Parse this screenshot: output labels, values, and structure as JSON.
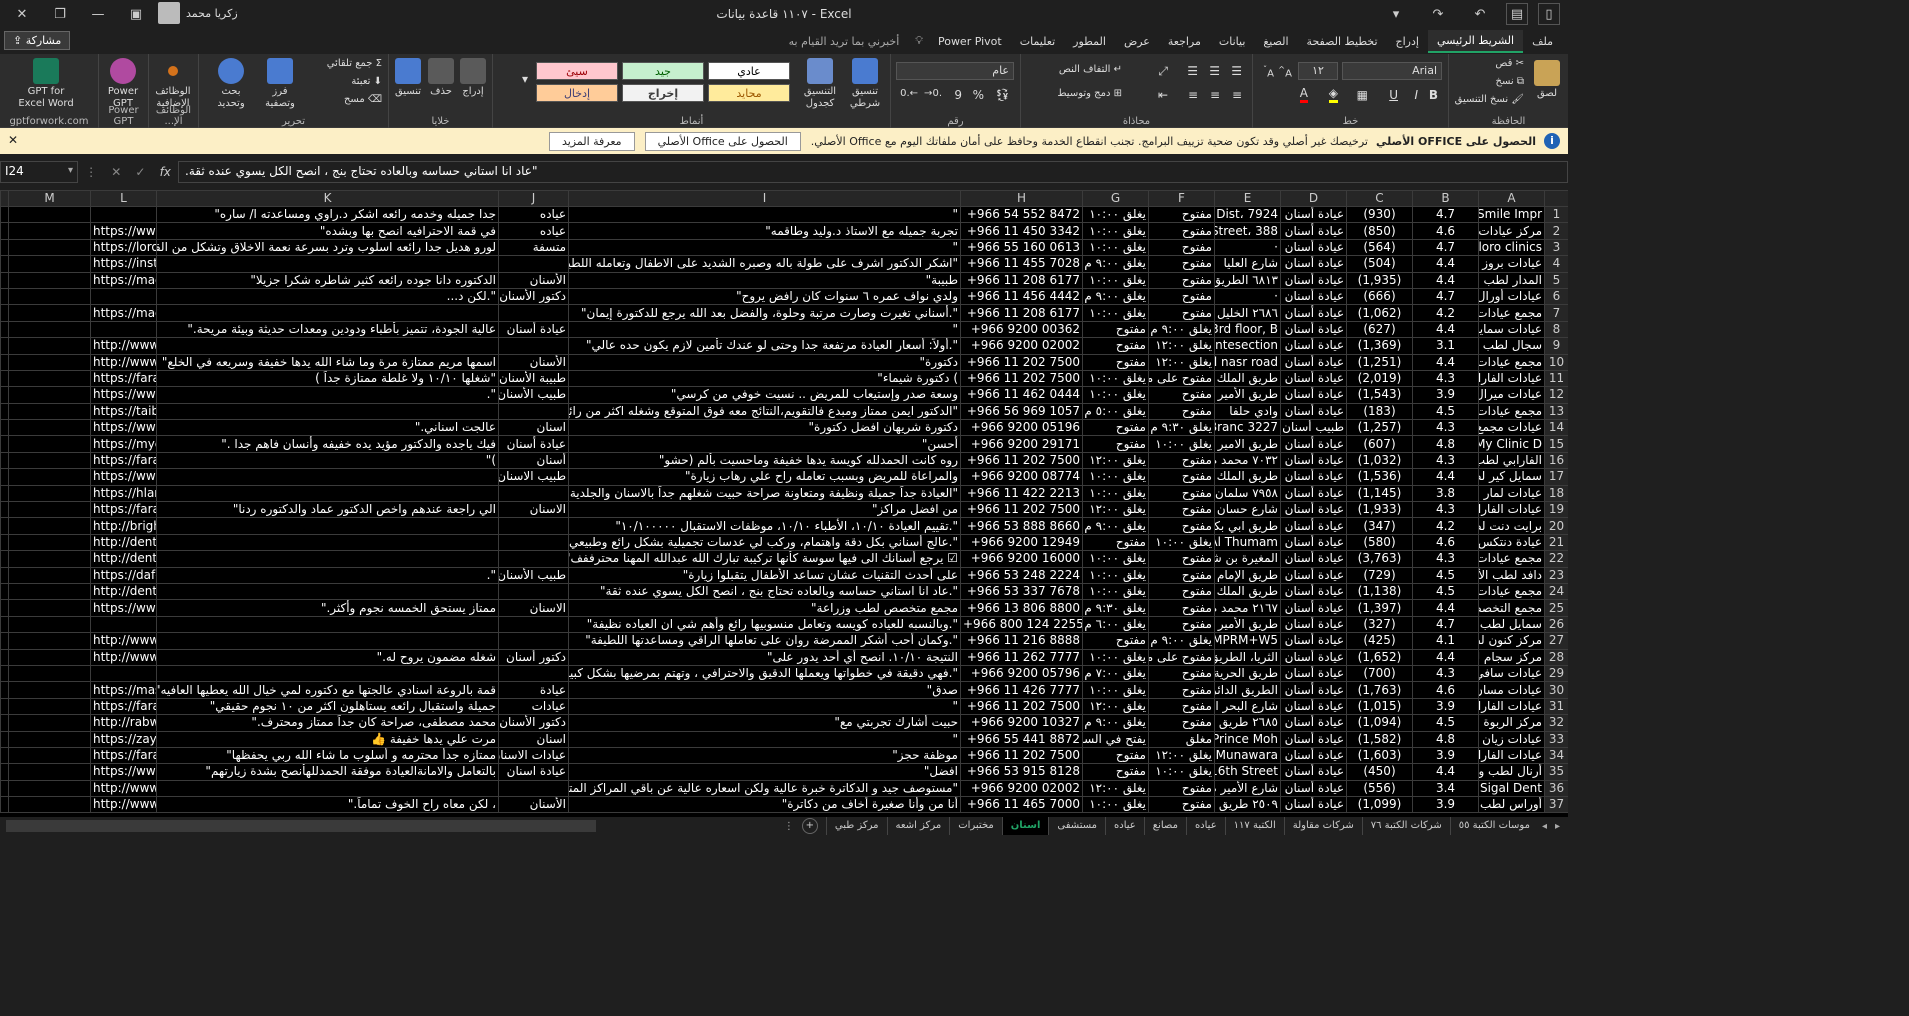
{
  "title_bar": {
    "title": "١١٠٧ قاعدة بيانات  -  Excel",
    "user": "زكريا محمد"
  },
  "tabs": [
    "ملف",
    "الشريط الرئيسي",
    "إدراج",
    "تخطيط الصفحة",
    "الصيغ",
    "بيانات",
    "مراجعة",
    "عرض",
    "المطور",
    "تعليمات",
    "Power Pivot"
  ],
  "active_tab_index": 1,
  "tell_me": "أخبرني بما تريد القيام به",
  "share": "مشاركة",
  "ribbon": {
    "clipboard": {
      "label": "الحافظة",
      "paste": "لصق",
      "cut": "قص",
      "copy": "نسخ",
      "format_painter": "نسخ التنسيق"
    },
    "font": {
      "label": "خط",
      "name": "Arial",
      "size": "١٢"
    },
    "alignment": {
      "label": "محاذاة",
      "wrap": "التفاف النص",
      "merge": "دمج وتوسيط"
    },
    "number": {
      "label": "رقم",
      "format": "عام"
    },
    "styles": {
      "label": "أنماط",
      "conditional": "تنسيق شرطي",
      "as_table": "التنسيق كجدول",
      "cells": [
        "عادي",
        "جيد",
        "سيئ",
        "محايد",
        "إخراج",
        "إدخال"
      ]
    },
    "cells_group": {
      "label": "خلايا",
      "insert": "إدراج",
      "delete": "حذف",
      "format": "تنسيق"
    },
    "editing": {
      "label": "تحرير",
      "autosum": "جمع تلقائي",
      "fill": "تعبئة",
      "clear": "مسح",
      "sort": "فرز وتصفية",
      "find": "بحث وتحديد"
    },
    "addins": {
      "label": "الوظائف الإ...",
      "addins_btn": "الوظائف الإضافية"
    },
    "powergpt": {
      "label": "Power GPT",
      "btn": "Power GPT"
    },
    "gptfor": {
      "label": "gptforwork.com",
      "btn": "GPT for Excel Word"
    }
  },
  "notification": {
    "title": "الحصول على OFFICE الأصلي",
    "message": "ترخيصك غير أصلي وقد تكون ضحية تزييف البرامج. تجنب انقطاع الخدمة وحافظ على أمان ملفاتك اليوم مع Office الأصلي.",
    "btn_get": "الحصول على Office الأصلي",
    "btn_more": "معرفة المزيد"
  },
  "formula_bar": {
    "cell": "I24",
    "fx": "fx",
    "content": "\"عاد انا استاني حساسه وبالعاده تحتاج بنج ، انصح الكل يسوي عنده ثقة."
  },
  "columns": [
    "M",
    "L",
    "K",
    "J",
    "I",
    "H",
    "G",
    "F",
    "E",
    "D",
    "C",
    "B",
    "A"
  ],
  "rows": [
    {
      "n": "1",
      "L": "",
      "K": "جدا جميله وخدمه رائعه اشكر د.راوي ومساعدته ا/ ساره\"",
      "J": "عياده",
      "I": "\"",
      "H": "+966 54 552 8472",
      "G": "يغلق ١٠:٠٠",
      "F": "مفتوح",
      "E": "7924 ،Dist",
      "D": "عيادة أسنان",
      "C": "(930)",
      "B": "4.7",
      "A": "Smile Impr"
    },
    {
      "n": "2",
      "L": "https://www",
      "K": "في قمة الاحترافيه انصح بها وبشده\"",
      "J": "عياده",
      "I": "تجربة جميله مع الاستاذ د.وليد وطاقمه\"",
      "H": "+966 11 450 3342",
      "G": "يغلق ١٠:٠٠",
      "F": "مفتوح",
      "E": "388 ،Street",
      "D": "عيادة أسنان",
      "C": "(850)",
      "B": "4.6",
      "A": "مركز عيادات"
    },
    {
      "n": "3",
      "L": "https://loroc",
      "K": "لورو هديل جدا رائعه اسلوب وترد بسرعة نعمة الاخلاق وتشكل من القلب\"",
      "J": "متسفة",
      "I": "\"",
      "H": "+966 55 160 0613",
      "G": "يغلق ١٠:٠٠",
      "F": "مفتوح",
      "E": "·",
      "D": "عيادة أسنان",
      "C": "(564)",
      "B": "4.7",
      "A": "loro clinics"
    },
    {
      "n": "4",
      "L": "https://insta",
      "K": "",
      "J": "",
      "I": "\"اشكر الدكتور اشرف على طولة باله وصبره الشديد على الاطفال وتعامله اللطيف معهم\"",
      "H": "+966 11 455 7028",
      "G": "يغلق ٩:٠٠ م",
      "F": "مفتوح",
      "E": "شارع العليا",
      "D": "عيادة أسنان",
      "C": "(504)",
      "B": "4.4",
      "A": "عيادات بروز لد"
    },
    {
      "n": "5",
      "L": "https://mad",
      "K": "الدكتوره دانا جوده رائعه كثير شاطره شكرا جزيلا\"",
      "J": "الأسنان",
      "I": "طبيبة\"",
      "H": "+966 11 208 6177",
      "G": "يغلق ١٠:٠٠",
      "F": "مفتوح",
      "E": "٦٨١٣ الطريق",
      "D": "عيادة أسنان",
      "C": "(1,935)",
      "B": "4.4",
      "A": "المدار لطب وتقو"
    },
    {
      "n": "6",
      "L": "",
      "K": "\".لكن د...",
      "J": "دكتور الأسنان",
      "I": "ولدي نواف عمره ٦ سنوات كان رافض يروح\"",
      "H": "+966 11 456 4442",
      "G": "يغلق ٩:٠٠ م",
      "F": "مفتوح",
      "E": "·",
      "D": "عيادة أسنان",
      "C": "(666)",
      "B": "4.7",
      "A": "عيادات أورال لد"
    },
    {
      "n": "7",
      "L": "https://mad",
      "K": "",
      "J": "",
      "I": "\".أسناني تغيرت وصارت مرتبة وحلوة، والفضل بعد الله يرجع للدكتورة إيمان\"",
      "H": "+966 11 208 6177",
      "G": "يغلق ١٠:٠٠",
      "F": "مفتوح",
      "E": "٢٦٨٦ الخليل ه",
      "D": "عيادة أسنان",
      "C": "(1,062)",
      "B": "4.2",
      "A": "مجمع عيادات ا"
    },
    {
      "n": "8",
      "L": "",
      "K": "عالية الجودة، تتميز بأطباء ودودين ومعدات حديثة وبيئة مريحة.\"",
      "J": "عيادة أسنان",
      "I": "\"",
      "H": "+966 9200 00362",
      "G": "مفتوح",
      "F": "يغلق ٩:٠٠ م",
      "E": "3rd floor, B",
      "D": "عيادة أسنان",
      "C": "(627)",
      "B": "4.4",
      "A": "عيادات سمايا لد"
    },
    {
      "n": "9",
      "L": "http://www.",
      "K": "",
      "J": "",
      "I": "\".أولاً: أسعار العيادة مرتفعة جدا وحتى لو عندك تأمين لازم يكون حده عالي\"",
      "H": "+966 9200 02002",
      "G": "مفتوح",
      "F": "يغلق ١٢:٠٠",
      "E": "Intesection",
      "D": "عيادة أسنان",
      "C": "(1,369)",
      "B": "3.1",
      "A": "سجال لطب الأسد"
    },
    {
      "n": "10",
      "L": "http://www.",
      "K": "اسمها مريم ممتازة مرة وما شاء الله يدها خفيفة وسريعه في الخلع\"",
      "J": "الأسنان",
      "I": "دكتورة\"",
      "H": "+966 11 202 7500",
      "G": "مفتوح",
      "F": "يغلق ١٢:٠٠",
      "E": "al nasr road",
      "D": "عيادة أسنان",
      "C": "(1,251)",
      "B": "4.4",
      "A": "مجمع عيادات ب"
    },
    {
      "n": "11",
      "L": "https://farat",
      "K": "\"شغلها ١٠/١٠ ولا غلطة ممتازة جداً )",
      "J": "طبيبة الأسنان",
      "I": ") دكتورة شيماء\"",
      "H": "+966 11 202 7500",
      "G": "يغلق ١٠:٠٠",
      "F": "مفتوح على مدار",
      "E": "طريق الملك عب",
      "D": "عيادة أسنان",
      "C": "(2,019)",
      "B": "4.3",
      "A": "عيادات الفارابي"
    },
    {
      "n": "12",
      "L": "https://www.",
      "K": "\".",
      "J": "طبيب الأسنان",
      "I": "وسعة صدر وإستيعاب للمريض .. نسيت خوفي من كرسي\"",
      "H": "+966 11 462 0444",
      "G": "يغلق ١٠:٠٠",
      "F": "مفتوح",
      "E": "طريق الأمير م",
      "D": "عيادة أسنان",
      "C": "(1,543)",
      "B": "3.9",
      "A": "عيادات ميرال لد"
    },
    {
      "n": "13",
      "L": "https://taiba",
      "K": "",
      "J": "",
      "I": "\"الدكتور ايمن ممتاز ومبدع فالتقويم،النتائج معه فوق المتوقع وشغله اكثر من رائع\"",
      "H": "+966 56 969 1057",
      "G": "يغلق ٥:٠٠ م",
      "F": "مفتوح",
      "E": "وادي حلفا",
      "D": "عيادة أسنان",
      "C": "(183)",
      "B": "4.5",
      "A": "مجمع عيادات ط"
    },
    {
      "n": "14",
      "L": "https://www",
      "K": "عالجت اسناني.\"",
      "J": "اسنان",
      "I": "دكتورة شريهان افضل دكتورة\"",
      "H": "+966 9200 05196",
      "G": "مفتوح",
      "F": "يغلق ٩:٣٠ م",
      "E": "3227 Branc",
      "D": "طبيب أسنان",
      "C": "(1,257)",
      "B": "4.3",
      "A": "عيادات مجمع"
    },
    {
      "n": "15",
      "L": "https://mycl",
      "K": "فيك ياجده والدكتور مؤيد يده خفيفه وأنسان فاهم جدا .\"",
      "J": "عيادة أسنان",
      "I": "أحسن\"",
      "H": "+966 9200 29171",
      "G": "مفتوح",
      "F": "يغلق ١٠:٠٠",
      "E": "طريق الامير س",
      "D": "عيادة أسنان",
      "C": "(607)",
      "B": "4.8",
      "A": "My Clinic D"
    },
    {
      "n": "16",
      "L": "https://farat",
      "K": ")\"",
      "J": "أسنان",
      "I": "روه كانت الحمدلله كويسة يدها خفيفة وماحسيت بألم (حشو\"",
      "H": "+966 11 202 7500",
      "G": "يغلق ١٢:٠٠",
      "F": "مفتوح",
      "E": "٧٠٣٢ محمد م",
      "D": "عيادة أسنان",
      "C": "(1,032)",
      "B": "4.3",
      "A": "الفارابي لطب و"
    },
    {
      "n": "17",
      "L": "https://www.",
      "K": "",
      "J": "طبيب الاسنان",
      "I": "والمراعاة للمريض وبسبب تعامله راح علي رهاب زيارة\"",
      "H": "+966 9200 08774",
      "G": "يغلق ١٠:٠٠",
      "F": "مفتوح",
      "E": "طريق الملك ع",
      "D": "عيادة أسنان",
      "C": "(1,536)",
      "B": "4.4",
      "A": "سمايل كير لطب"
    },
    {
      "n": "18",
      "L": "https://hlarc",
      "K": "",
      "J": "",
      "I": "\"العيادة جداً جميلة ونظيفة ومتعاونة صراحة حبيت شغلهم جداً بالاسنان والجلدية\"",
      "H": "+966 11 422 2213",
      "G": "يغلق ١٠:٠٠",
      "F": "مفتوح",
      "E": "٧٩٥٨ سلمان",
      "D": "عيادة أسنان",
      "C": "(1,145)",
      "B": "3.8",
      "A": "عيادات لمار لطب"
    },
    {
      "n": "19",
      "L": "https://farat",
      "K": "الي راجعة عندهم واخص الدكتور عماد والدكتوره ردنا\"",
      "J": "الاسنان",
      "I": "من افضل مراكز\"",
      "H": "+966 11 202 7500",
      "G": "يغلق ١٢:٠٠",
      "F": "مفتوح",
      "E": "شارع حسان بن",
      "D": "عيادة أسنان",
      "C": "(1,933)",
      "B": "4.3",
      "A": "عيادات الفارابي"
    },
    {
      "n": "20",
      "L": "http://bright",
      "K": "",
      "J": "",
      "I": "\".تقييم العيادة ١٠/١٠، الأطباء ١٠/١٠، موظفات الاستقبال ١٠/١٠٠٠٠٠\"",
      "H": "+966 53 888 8660",
      "G": "يغلق ٩:٠٠ م",
      "F": "مفتوح",
      "E": "طريق ابي بكر",
      "D": "عيادة أسنان",
      "C": "(347)",
      "B": "4.2",
      "A": "برايت دنت لطب"
    },
    {
      "n": "21",
      "L": "http://dente",
      "K": "",
      "J": "",
      "I": "\".عالج أسناني بكل دقة واهتمام، وركب لي عدسات تجميلية بشكل رائع وطبيعي\"",
      "H": "+966 9200 12949",
      "G": "مفتوح",
      "F": "يغلق ١٠:٠٠",
      "E": "Al Thumam",
      "D": "عيادة أسنان",
      "C": "(580)",
      "B": "4.6",
      "A": "عيادة دنتكس لط"
    },
    {
      "n": "22",
      "L": "http://dent-s",
      "K": "",
      "J": "",
      "I": "☑ يرجع أسنانك الى فيها سوسة كأنها تركيبة تبارك الله عبدالله المهنا محترففف\"",
      "H": "+966 9200 16000",
      "G": "يغلق ١٠:٠٠",
      "F": "مفتوح",
      "E": "المغيرة بن شعب",
      "D": "عيادة أسنان",
      "C": "(3,763)",
      "B": "4.3",
      "A": "مجمع عيادات د"
    },
    {
      "n": "23",
      "L": "https://dafd",
      "K": "\".",
      "J": "طبيب الأسنان",
      "I": "على أحدث التقنيات عشان تساعد الأطفال يتقبلوا زيارة\"",
      "H": "+966 53 248 2224",
      "G": "يغلق ١٠:٠٠",
      "F": "مفتوح",
      "E": "طريق الإمام م",
      "D": "عيادة أسنان",
      "C": "(729)",
      "B": "4.5",
      "A": "دافد لطب الأسنا"
    },
    {
      "n": "24",
      "L": "http://dentc",
      "K": "",
      "J": "",
      "I": "\".عاد انا استاني حساسه وبالعاده تحتاج بنج ، انصح الكل يسوي عنده ثقة\"",
      "H": "+966 53 337 7678",
      "G": "يغلق ١٠:٠٠",
      "F": "مفتوح",
      "E": "طريق الملك فهد",
      "D": "عيادة أسنان",
      "C": "(1,138)",
      "B": "4.5",
      "A": "مجمع عيادات د"
    },
    {
      "n": "25",
      "L": "https://www.",
      "K": "ممتاز يستحق الخمسه نجوم وأكثر.\"",
      "J": "الاسنان",
      "I": "مجمع متخصص لطب وزراعة\"",
      "H": "+966 13 806 8800",
      "G": "يغلق ٩:٣٠ م",
      "F": "مفتوح",
      "E": "٢١٦٧ محمد م",
      "D": "عيادة أسنان",
      "C": "(1,397)",
      "B": "4.4",
      "A": "مجمع التخصص"
    },
    {
      "n": "26",
      "L": "",
      "K": "",
      "J": "",
      "I": "\".وبالنسبه للعياده كويسه وتعامل منسوبيها رائع وأهم شي ان العياده نظيفة\"",
      "H": "+966 800 124 2255",
      "G": "يغلق ٦:٠٠ م",
      "F": "مفتوح",
      "E": "طريق الأمير",
      "D": "عيادة أسنان",
      "C": "(327)",
      "B": "4.7",
      "A": "سمايل لطب وتقو"
    },
    {
      "n": "27",
      "L": "http://www.",
      "K": "",
      "J": "",
      "I": "\".وكمان أحب أشكر الممرضة روان على تعاملها الراقي ومساعدتها اللطيفة\"",
      "H": "+966 11 216 8888",
      "G": "مفتوح",
      "F": "يغلق ٩:٠٠ م",
      "E": "MPRM+W5",
      "D": "عيادة أسنان",
      "C": "(425)",
      "B": "4.1",
      "A": "مركز كنون لطب"
    },
    {
      "n": "28",
      "L": "http://www.",
      "K": "شغله مضمون يروح له.\"",
      "J": "دكتور أسنان",
      "I": "النتيجة ١٠/١٠. انصح أي أحد يدور على\"",
      "H": "+966 11 262 7777",
      "G": "يغلق ١٠:٠٠",
      "F": "مفتوح على مدار",
      "E": "الثريا، الطريق",
      "D": "عيادة أسنان",
      "C": "(1,652)",
      "B": "4.4",
      "A": "مركز سجام لطب"
    },
    {
      "n": "29",
      "L": "",
      "K": "",
      "J": "",
      "I": "\".فهي دقيقة في خطواتها ويعملها الدقيق والاحترافي ، وتهتم بمرضيها بشكل كبير\"",
      "H": "+966 9200 05796",
      "G": "يغلق ٧:٠٠ م",
      "F": "مفتوح",
      "E": "طريق الحرية",
      "D": "عيادة أسنان",
      "C": "(700)",
      "B": "4.3",
      "A": "عيادات سافي لد"
    },
    {
      "n": "30",
      "L": "https://mas",
      "K": "قمة بالروعة اسنادي عالجتها مع دكتوره لمي خيال الله يعطيها العافيه\"",
      "J": "عيادة",
      "I": "صدق\"",
      "H": "+966 11 426 7777",
      "G": "يغلق ١٠:٠٠",
      "F": "مفتوح",
      "E": "الطريق الدائري",
      "D": "عيادة أسنان",
      "C": "(1,763)",
      "B": "4.6",
      "A": "عيادات مسان الد"
    },
    {
      "n": "31",
      "L": "https://farat",
      "K": "جميلة واستقبال رائعه يستاهلون اكثر من ١٠ نجوم حقيقي\"",
      "J": "عيادات",
      "I": "\"",
      "H": "+966 11 202 7500",
      "G": "يغلق ١٢:٠٠",
      "F": "مفتوح",
      "E": "شارع البحر الأ",
      "D": "عيادة أسنان",
      "C": "(1,015)",
      "B": "3.9",
      "A": "عيادات الفارابي"
    },
    {
      "n": "32",
      "L": "http://rabwa",
      "K": "محمد مصطفى، صراحة كان جداً ممتاز ومحترف.\"",
      "J": "دكتور الأسنان",
      "I": "حبيت أشارك تجربتي مع\"",
      "H": "+966 9200 10327",
      "G": "يغلق ٩:٠٠ م",
      "F": "مفتوح",
      "E": "٢٦٨٥ طريق ا",
      "D": "عيادة أسنان",
      "C": "(1,094)",
      "B": "4.5",
      "A": "مركز الربوة الد"
    },
    {
      "n": "33",
      "L": "https://zaya",
      "K": "مرت علي يدها خفيفة 👍",
      "J": "اسنان",
      "I": "\"",
      "H": "+966 55 441 8872",
      "G": "يفتح في الساع",
      "F": "مغلق",
      "E": "Prince Moh",
      "D": "عيادة أسنان",
      "C": "(1,582)",
      "B": "4.8",
      "A": "عيادات زيان لد"
    },
    {
      "n": "34",
      "L": "https://farat",
      "K": "ممتازه جدأ محترمه و أسلوب ما شاء الله ربي يحفظها\"",
      "J": "عيادات الاسنان",
      "I": "موظفة حجز\"",
      "H": "+966 11 202 7500",
      "G": "مفتوح",
      "F": "يغلق ١٢:٠٠",
      "E": "Munawara",
      "D": "عيادة أسنان",
      "C": "(1,603)",
      "B": "3.9",
      "A": "عيادات الفارابي"
    },
    {
      "n": "35",
      "L": "https://www.",
      "K": "بالتعامل والامانةالعيادة موفقة الحمدللهأنصح بشدة زيارتهم\"",
      "J": "عيادة اسنان",
      "I": "افضل\"",
      "H": "+966 53 915 8128",
      "G": "مفتوح",
      "F": "يغلق ١٠:٠٠",
      "E": "16th Street",
      "D": "عيادة أسنان",
      "C": "(450)",
      "B": "4.4",
      "A": "أرنال لطب وتقو"
    },
    {
      "n": "36",
      "L": "http://www.",
      "K": "",
      "J": "",
      "I": "\"مستوصف جيد و الدكاترة خبرة عالية ولكن اسعاره عالية عن باقي المراكز المتخصصة\"",
      "H": "+966 9200 02002",
      "G": "يغلق ١٢:٠٠",
      "F": "مفتوح",
      "E": "شارع الأمير م",
      "D": "عيادة أسنان",
      "C": "(556)",
      "B": "3.4",
      "A": "Sigal Dent"
    },
    {
      "n": "37",
      "L": "http://www.",
      "K": "، لكن معاه راح الخوف تماماً.\"",
      "J": "الأسنان",
      "I": "أنا من وأنا صغيرة أخاف من دكاترة\"",
      "H": "+966 11 465 7000",
      "G": "يغلق ١٠:٠٠",
      "F": "مفتوح",
      "E": "٢٥٠٩ طريق ا",
      "D": "عيادة أسنان",
      "C": "(1,099)",
      "B": "3.9",
      "A": "أوراس لطب الأ"
    }
  ],
  "sheet_tabs": [
    "موسات الكتبة ٥٥",
    "شركات الكتبة ٧٦",
    "شركات مقاولة",
    "الكتبة ١١٧",
    "عياده",
    "مصانع",
    "عياده",
    "مستشفى",
    "اسنان",
    "مختبرات",
    "مركز اشعه",
    "مركز طبي"
  ],
  "active_sheet_index": 8
}
